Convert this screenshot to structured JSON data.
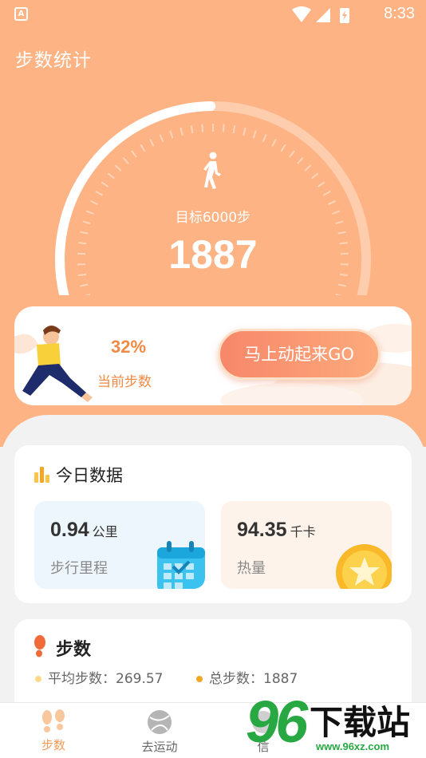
{
  "status_bar": {
    "app_badge": "A",
    "time": "8:33",
    "icons": [
      "wifi-icon",
      "signal-icon",
      "battery-charging-icon"
    ]
  },
  "page_title": "步数统计",
  "progress": {
    "goal_label": "目标6000步",
    "steps": "1887",
    "percent": 32
  },
  "promo": {
    "percent_text": "32%",
    "label": "当前步数",
    "go_button": "马上动起来GO"
  },
  "today": {
    "title": "今日数据",
    "distance": {
      "value": "0.94",
      "unit": "公里",
      "label": "步行里程"
    },
    "calories": {
      "value": "94.35",
      "unit": "千卡",
      "label": "热量"
    }
  },
  "step_card": {
    "title": "步数",
    "avg": "平均步数：269.57",
    "total": "总步数：1887"
  },
  "tabs": [
    {
      "label": "步数",
      "icon": "footprints-icon",
      "active": true
    },
    {
      "label": "去运动",
      "icon": "ball-icon",
      "active": false
    },
    {
      "label": "信",
      "icon": "tab-icon",
      "active": false
    }
  ],
  "watermark": {
    "number": "96",
    "text": "下载站",
    "url": "www.96xz.com"
  },
  "colors": {
    "header_bg": "#fdb383",
    "accent": "#f08a45",
    "tab_active": "#f59b5a",
    "watermark_green": "#27a843"
  }
}
